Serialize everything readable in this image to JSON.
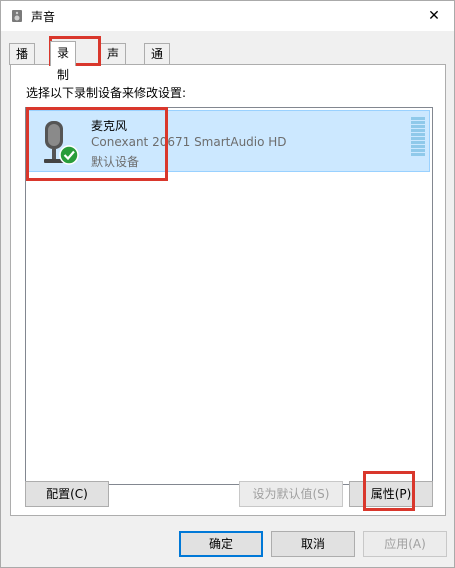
{
  "window": {
    "title": "声音",
    "close_glyph": "✕"
  },
  "tabs": [
    {
      "label": "播放",
      "active": false
    },
    {
      "label": "录制",
      "active": true
    },
    {
      "label": "声音",
      "active": false
    },
    {
      "label": "通信",
      "active": false
    }
  ],
  "panel": {
    "instruction": "选择以下录制设备来修改设置:",
    "devices": [
      {
        "name": "麦克风",
        "description": "Conexant 20671 SmartAudio HD",
        "status": "默认设备",
        "icon": "microphone-icon",
        "badge": "check-icon",
        "selected": true
      }
    ],
    "buttons": {
      "configure": "配置(C)",
      "set_default": "设为默认值(S)",
      "properties": "属性(P)"
    }
  },
  "footer": {
    "ok": "确定",
    "cancel": "取消",
    "apply": "应用(A)"
  },
  "colors": {
    "selection_bg": "#cce8ff",
    "selection_border": "#99d1ff",
    "highlight": "#d9372c",
    "accent": "#0078d7",
    "check_green": "#2a9d3a"
  }
}
